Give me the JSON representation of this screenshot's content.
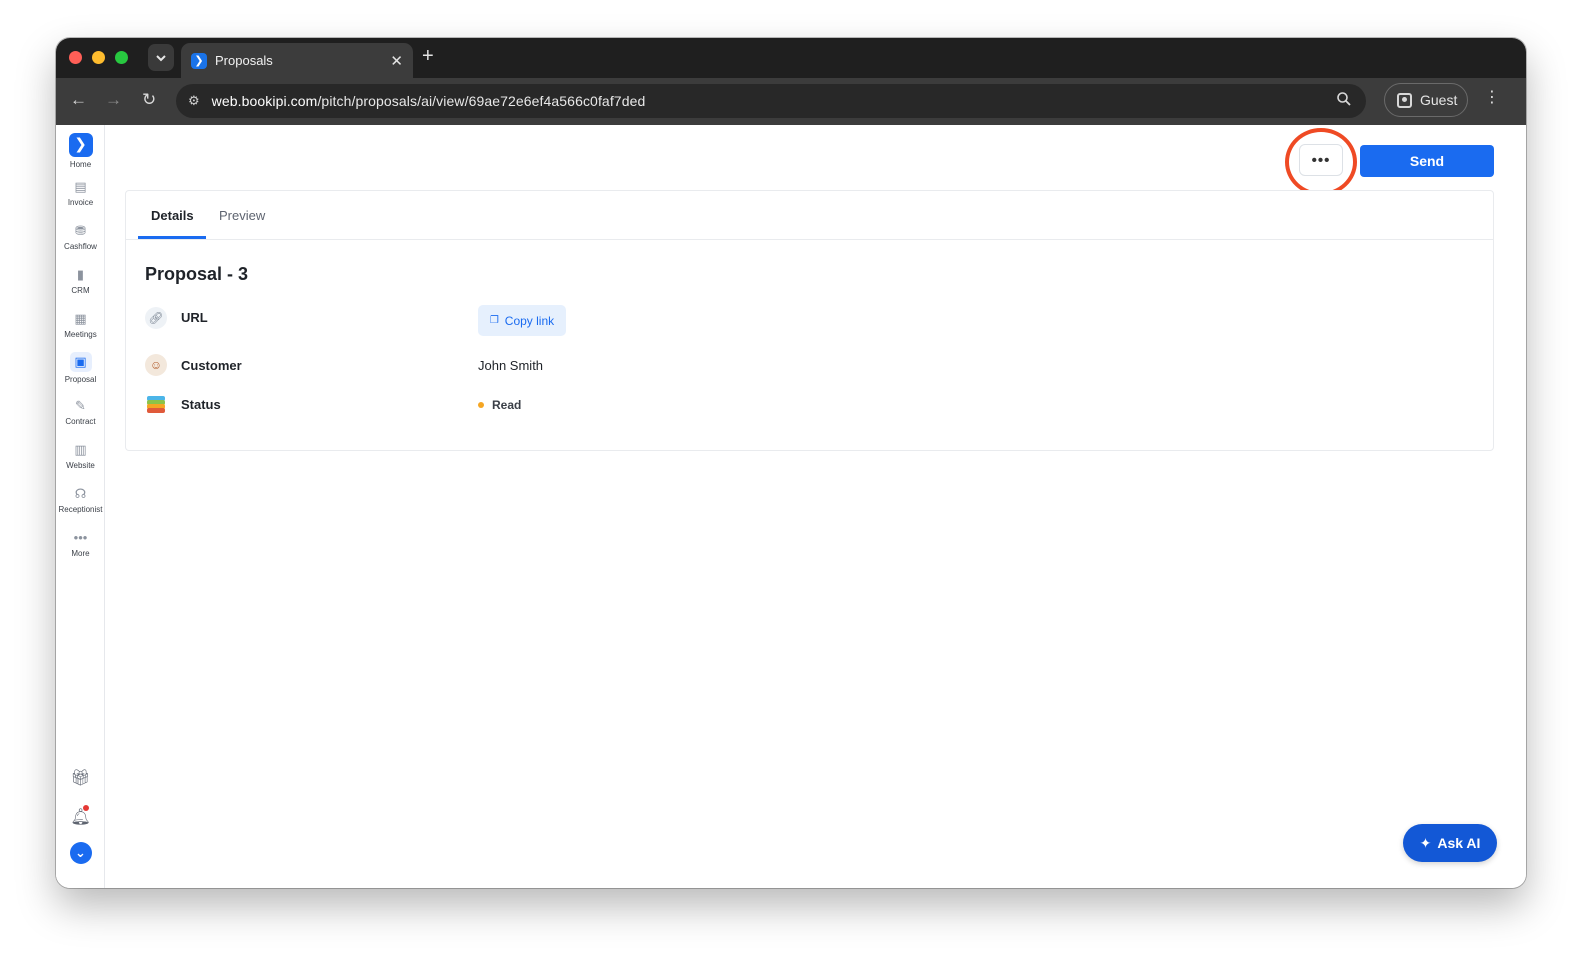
{
  "browser": {
    "tab_title": "Proposals",
    "url_host": "web.bookipi.com",
    "url_path": "/pitch/proposals/ai/view/69ae72e6ef4a566c0faf7ded",
    "profile_label": "Guest"
  },
  "sidebar": {
    "items": [
      {
        "label": "Home",
        "icon": "bookipi-logo-icon"
      },
      {
        "label": "Invoice",
        "icon": "invoice-icon"
      },
      {
        "label": "Cashflow",
        "icon": "cashflow-icon"
      },
      {
        "label": "CRM",
        "icon": "crm-chart-icon"
      },
      {
        "label": "Meetings",
        "icon": "calendar-icon"
      },
      {
        "label": "Proposal",
        "icon": "proposal-icon",
        "active": true
      },
      {
        "label": "Contract",
        "icon": "contract-icon"
      },
      {
        "label": "Website",
        "icon": "website-icon"
      },
      {
        "label": "Receptionist",
        "icon": "headset-icon"
      },
      {
        "label": "More",
        "icon": "more-dots-icon"
      }
    ]
  },
  "actions": {
    "more_label": "•••",
    "send_label": "Send"
  },
  "tabs": {
    "details": "Details",
    "preview": "Preview"
  },
  "proposal": {
    "title": "Proposal - 3",
    "url_label": "URL",
    "copy_link_label": "Copy link",
    "customer_label": "Customer",
    "customer_value": "John Smith",
    "status_label": "Status",
    "status_value": "Read"
  },
  "ask_ai_label": "Ask AI",
  "colors": {
    "primary": "#1a6bf0",
    "highlight_ring": "#ef4a24",
    "status_read": "#f5a623"
  }
}
